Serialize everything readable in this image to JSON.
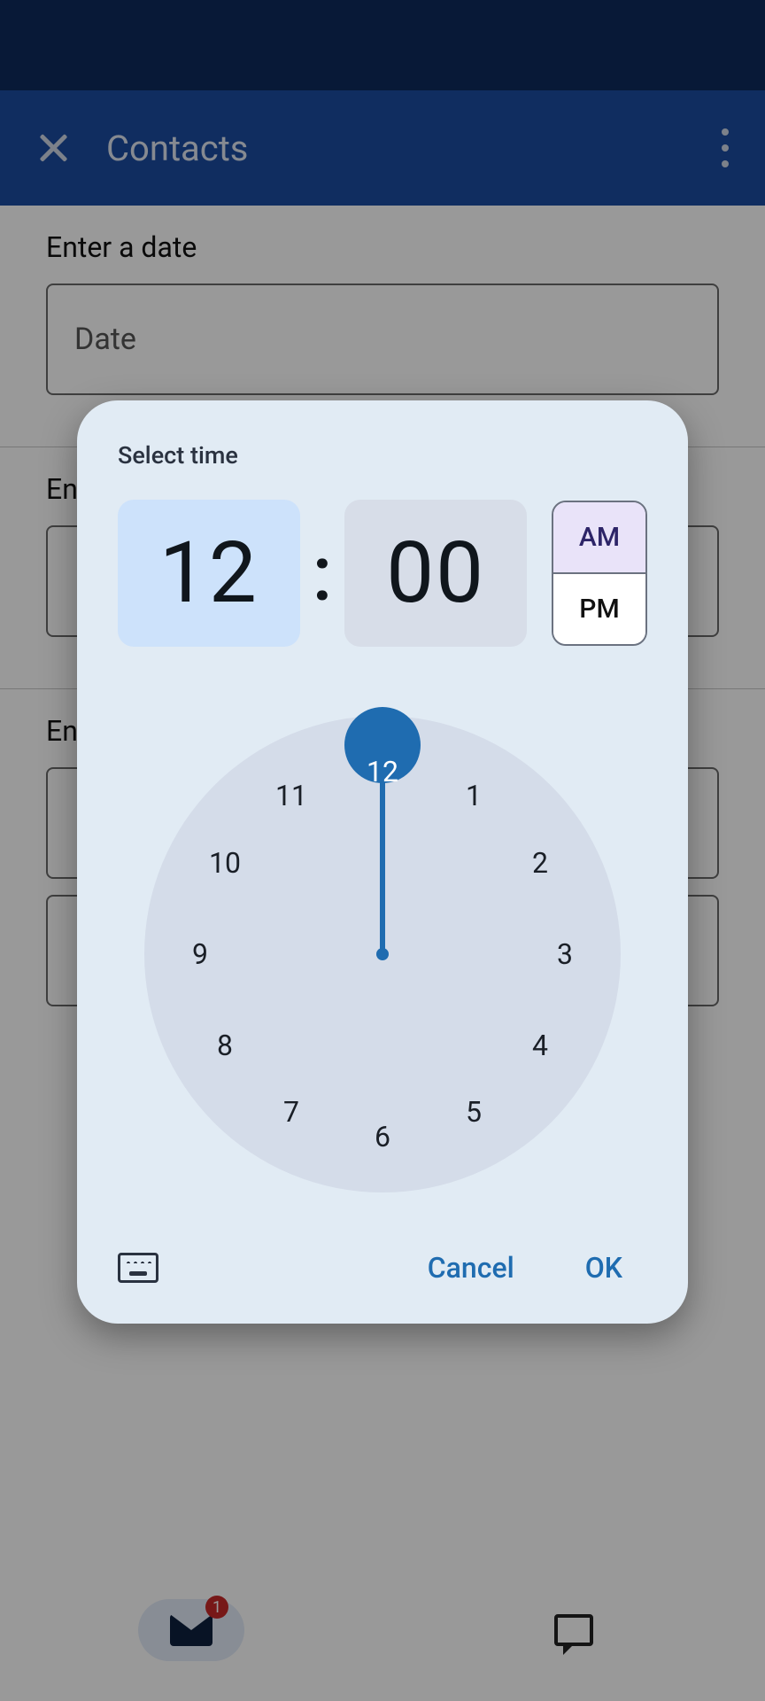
{
  "app_bar": {
    "title": "Contacts"
  },
  "sections": {
    "date": {
      "label": "Enter a date",
      "field_placeholder": "Date"
    },
    "section2_label_visible": "En",
    "section3_label_visible": "En"
  },
  "nav": {
    "mail_badge": "1"
  },
  "dialog": {
    "title": "Select time",
    "hour": "12",
    "minute": "00",
    "am": "AM",
    "pm": "PM",
    "selected_period": "AM",
    "clock_hours": {
      "12": "12",
      "1": "1",
      "2": "2",
      "3": "3",
      "4": "4",
      "5": "5",
      "6": "6",
      "7": "7",
      "8": "8",
      "9": "9",
      "10": "10",
      "11": "11"
    },
    "cancel": "Cancel",
    "ok": "OK"
  }
}
